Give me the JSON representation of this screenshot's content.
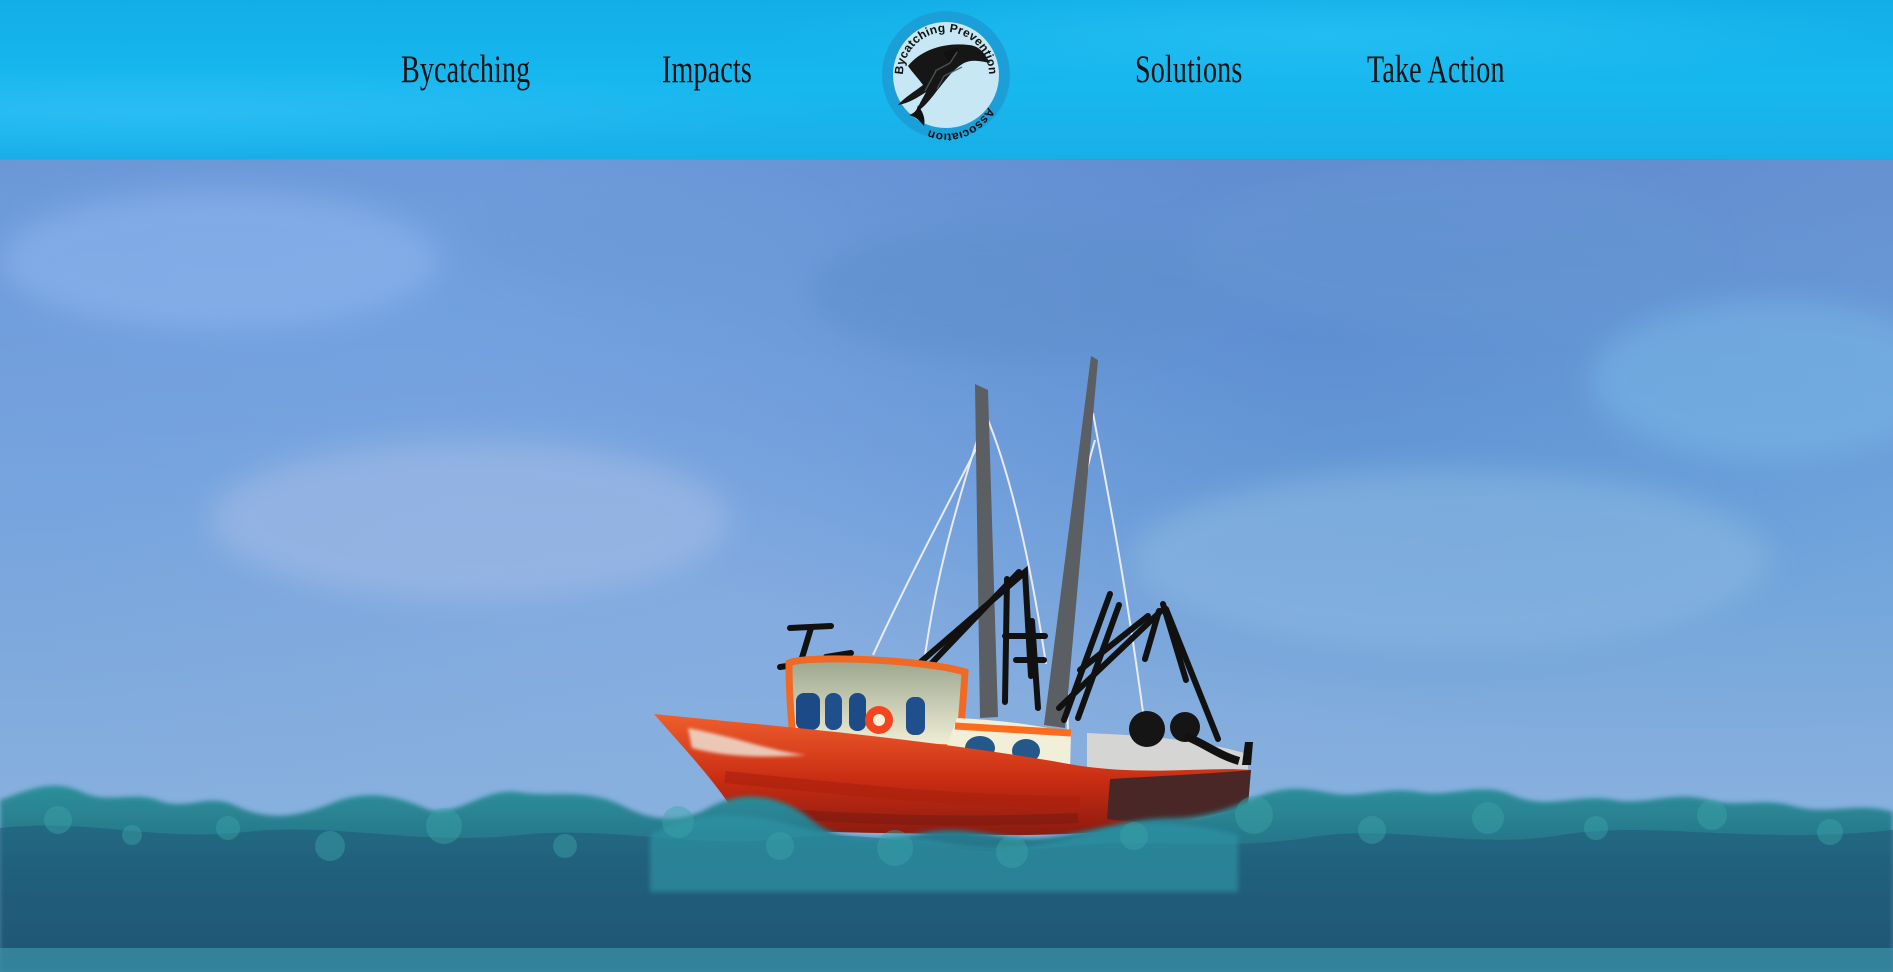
{
  "nav": {
    "items": [
      {
        "label": "Bycatching"
      },
      {
        "label": "Impacts"
      },
      {
        "label": "Solutions"
      },
      {
        "label": "Take Action"
      }
    ]
  },
  "logo": {
    "top_text": "Bycatching Prevention",
    "bottom_text": "Association",
    "icon": "dolphin-icon"
  },
  "colors": {
    "header": "#17b8ef",
    "sky": "#7fa8dc",
    "sea": "#2f6f83",
    "boat_hull": "#cf3014"
  }
}
